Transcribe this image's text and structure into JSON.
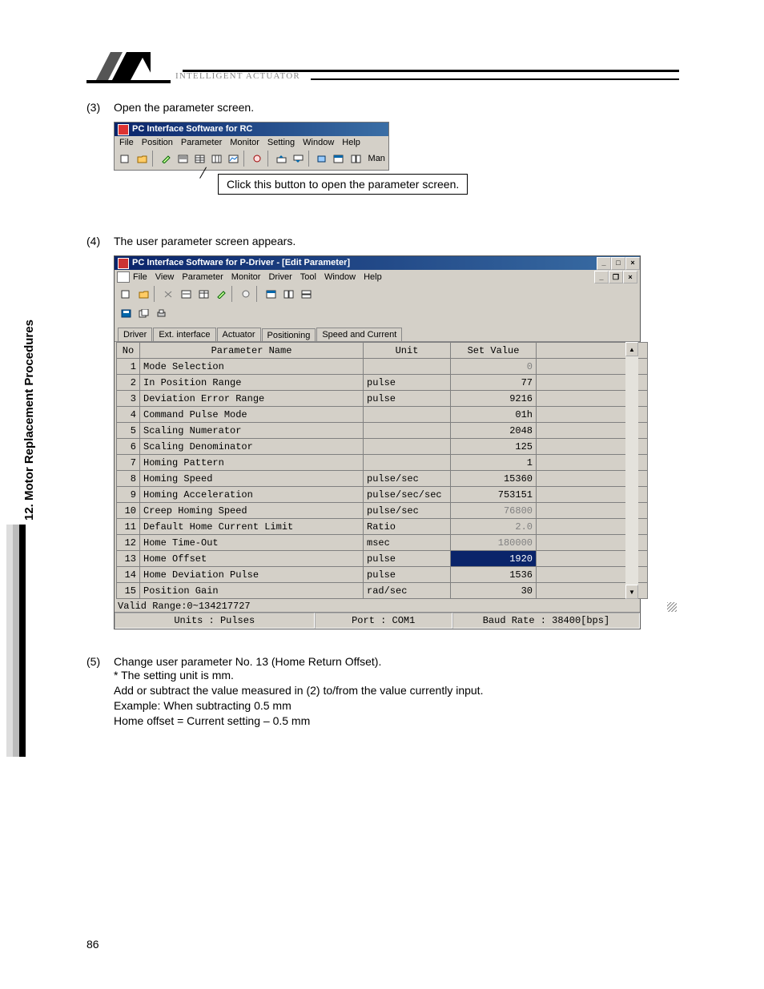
{
  "header": {
    "brand": "INTELLIGENT ACTUATOR"
  },
  "sidebar": {
    "chapter": "12. Motor Replacement Procedures"
  },
  "page_number": "86",
  "steps": {
    "s3_num": "(3)",
    "s3_text": "Open the parameter screen.",
    "s3_callout": "Click this button to open the parameter screen.",
    "s4_num": "(4)",
    "s4_text": "The user parameter screen appears.",
    "s5_num": "(5)",
    "s5_line1": "Change user parameter No. 13 (Home Return Offset).",
    "s5_line2": "* The setting unit is mm.",
    "s5_line3": "Add or subtract the value measured in (2) to/from the value currently input.",
    "s5_line4": "Example: When subtracting 0.5 mm",
    "s5_line5": "Home offset = Current setting – 0.5 mm"
  },
  "shot1": {
    "title": "PC Interface Software for RC",
    "menus": [
      "File",
      "Position",
      "Parameter",
      "Monitor",
      "Setting",
      "Window",
      "Help"
    ],
    "toolbar_text": "Man"
  },
  "shot2": {
    "title": "PC Interface Software for P-Driver - [Edit Parameter]",
    "menus": [
      "File",
      "View",
      "Parameter",
      "Monitor",
      "Driver",
      "Tool",
      "Window",
      "Help"
    ],
    "tabs": [
      "Driver",
      "Ext. interface",
      "Actuator",
      "Positioning",
      "Speed and Current"
    ],
    "active_tab": 3,
    "headers": {
      "no": "No",
      "name": "Parameter Name",
      "unit": "Unit",
      "val": "Set Value"
    },
    "rows": [
      {
        "no": "1",
        "name": "Mode Selection",
        "unit": "",
        "value": "0",
        "faded": true
      },
      {
        "no": "2",
        "name": "In Position Range",
        "unit": "pulse",
        "value": "77"
      },
      {
        "no": "3",
        "name": "Deviation Error Range",
        "unit": "pulse",
        "value": "9216"
      },
      {
        "no": "4",
        "name": "Command Pulse Mode",
        "unit": "",
        "value": "01h"
      },
      {
        "no": "5",
        "name": "Scaling Numerator",
        "unit": "",
        "value": "2048"
      },
      {
        "no": "6",
        "name": "Scaling Denominator",
        "unit": "",
        "value": "125"
      },
      {
        "no": "7",
        "name": "Homing Pattern",
        "unit": "",
        "value": "1"
      },
      {
        "no": "8",
        "name": "Homing Speed",
        "unit": "pulse/sec",
        "value": "15360"
      },
      {
        "no": "9",
        "name": "Homing Acceleration",
        "unit": "pulse/sec/sec",
        "value": "753151"
      },
      {
        "no": "10",
        "name": "Creep Homing Speed",
        "unit": "pulse/sec",
        "value": "76800",
        "faded": true
      },
      {
        "no": "11",
        "name": "Default Home Current Limit",
        "unit": "Ratio",
        "value": "2.0",
        "faded": true
      },
      {
        "no": "12",
        "name": "Home Time-Out",
        "unit": "msec",
        "value": "180000",
        "faded": true
      },
      {
        "no": "13",
        "name": "Home Offset",
        "unit": "pulse",
        "value": "1920",
        "highlight": true
      },
      {
        "no": "14",
        "name": "Home Deviation Pulse",
        "unit": "pulse",
        "value": "1536"
      },
      {
        "no": "15",
        "name": "Position Gain",
        "unit": "rad/sec",
        "value": "30"
      }
    ],
    "valid_range": "Valid Range:0~134217727",
    "status": {
      "units": "Units : Pulses",
      "port": "Port : COM1",
      "baud": "Baud Rate : 38400[bps]"
    }
  }
}
